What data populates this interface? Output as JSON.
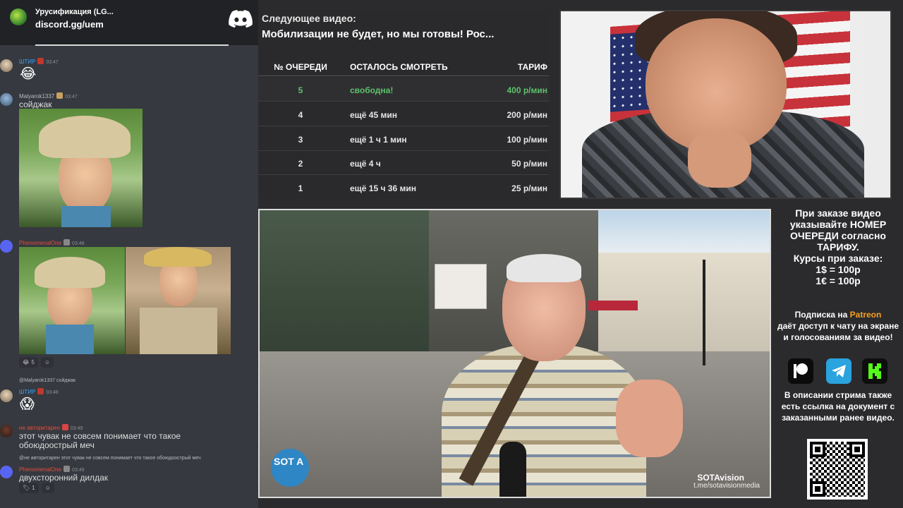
{
  "server": {
    "name": "Урусификация (LG...",
    "link": "discord.gg/uem"
  },
  "chat": [
    {
      "author": "ШТИР",
      "author_color": "#3ba5ff",
      "time": "03:47",
      "emoji": "😂"
    },
    {
      "author": "Malyarok1337",
      "author_color": "#b9bbbe",
      "time": "03:47",
      "text": "сойджак"
    },
    {
      "author": "PhenomenalOne",
      "author_color": "#e74c3c",
      "time": "03:48",
      "reactions": [
        {
          "emoji": "😂",
          "count": "5"
        },
        {
          "emoji": "☺",
          "count": ""
        }
      ]
    },
    {
      "reply": "@Malyarok1337 сойджак",
      "author": "ШТИР",
      "author_color": "#3ba5ff",
      "time": "03:48",
      "emoji": "😱"
    },
    {
      "author": "не авторитарен",
      "author_color": "#e74c3c",
      "time": "03:49",
      "text_line1": "этот чувак не совсем понимает что такое",
      "text_line2": "обоюдоострый меч"
    },
    {
      "reply": "@не авторитарен этот чувак не совсем понимает что такое обоюдоострый меч",
      "author": "PhenomenalOne",
      "author_color": "#e74c3c",
      "time": "03:49",
      "text": "двухсторонний дилдак",
      "reactions": [
        {
          "emoji": "🏷",
          "count": "1"
        },
        {
          "emoji": "☺",
          "count": ""
        }
      ]
    }
  ],
  "queue": {
    "kicker": "Следующее видео:",
    "title": "Мобилизации не будет, но мы готовы! Рос...",
    "headers": [
      "№ ОЧЕРЕДИ",
      "ОСТАЛОСЬ СМОТРЕТЬ",
      "ТАРИФ"
    ],
    "rows": [
      {
        "num": "5",
        "remaining": "свободна!",
        "price": "400 р/мин",
        "active": true
      },
      {
        "num": "4",
        "remaining": "ещё 45 мин",
        "price": "200 р/мин"
      },
      {
        "num": "3",
        "remaining": "ещё 1 ч 1 мин",
        "price": "100 р/мин"
      },
      {
        "num": "2",
        "remaining": "ещё 4 ч",
        "price": "50 р/мин"
      },
      {
        "num": "1",
        "remaining": "ещё 15 ч 36 мин",
        "price": "25 р/мин"
      }
    ]
  },
  "video": {
    "logo": "SOT A",
    "brand": "SOTAvision",
    "url": "t.me/sotavisionmedia"
  },
  "info": {
    "lines": [
      "При заказе видео",
      "указывайте НОМЕР",
      "ОЧЕРЕДИ согласно",
      "ТАРИФУ.",
      "Курсы при заказе:",
      "1$ = 100р",
      "1€ = 100р"
    ],
    "sub_before": "Подписка на ",
    "sub_patreon": "Patreon",
    "sub_after": "даёт доступ к чату на экране и голосованиям за видео!",
    "desc": "В описании стрима также есть ссылка на документ с заказанными ранее видео."
  },
  "colors": {
    "accent_green": "#5cc26a",
    "patreon": "#f9a11b",
    "telegram": "#2aa3df",
    "discord": "#5865f2"
  },
  "icons": [
    "discord-icon",
    "patreon-icon",
    "telegram-icon",
    "kick-icon",
    "qr-code"
  ]
}
